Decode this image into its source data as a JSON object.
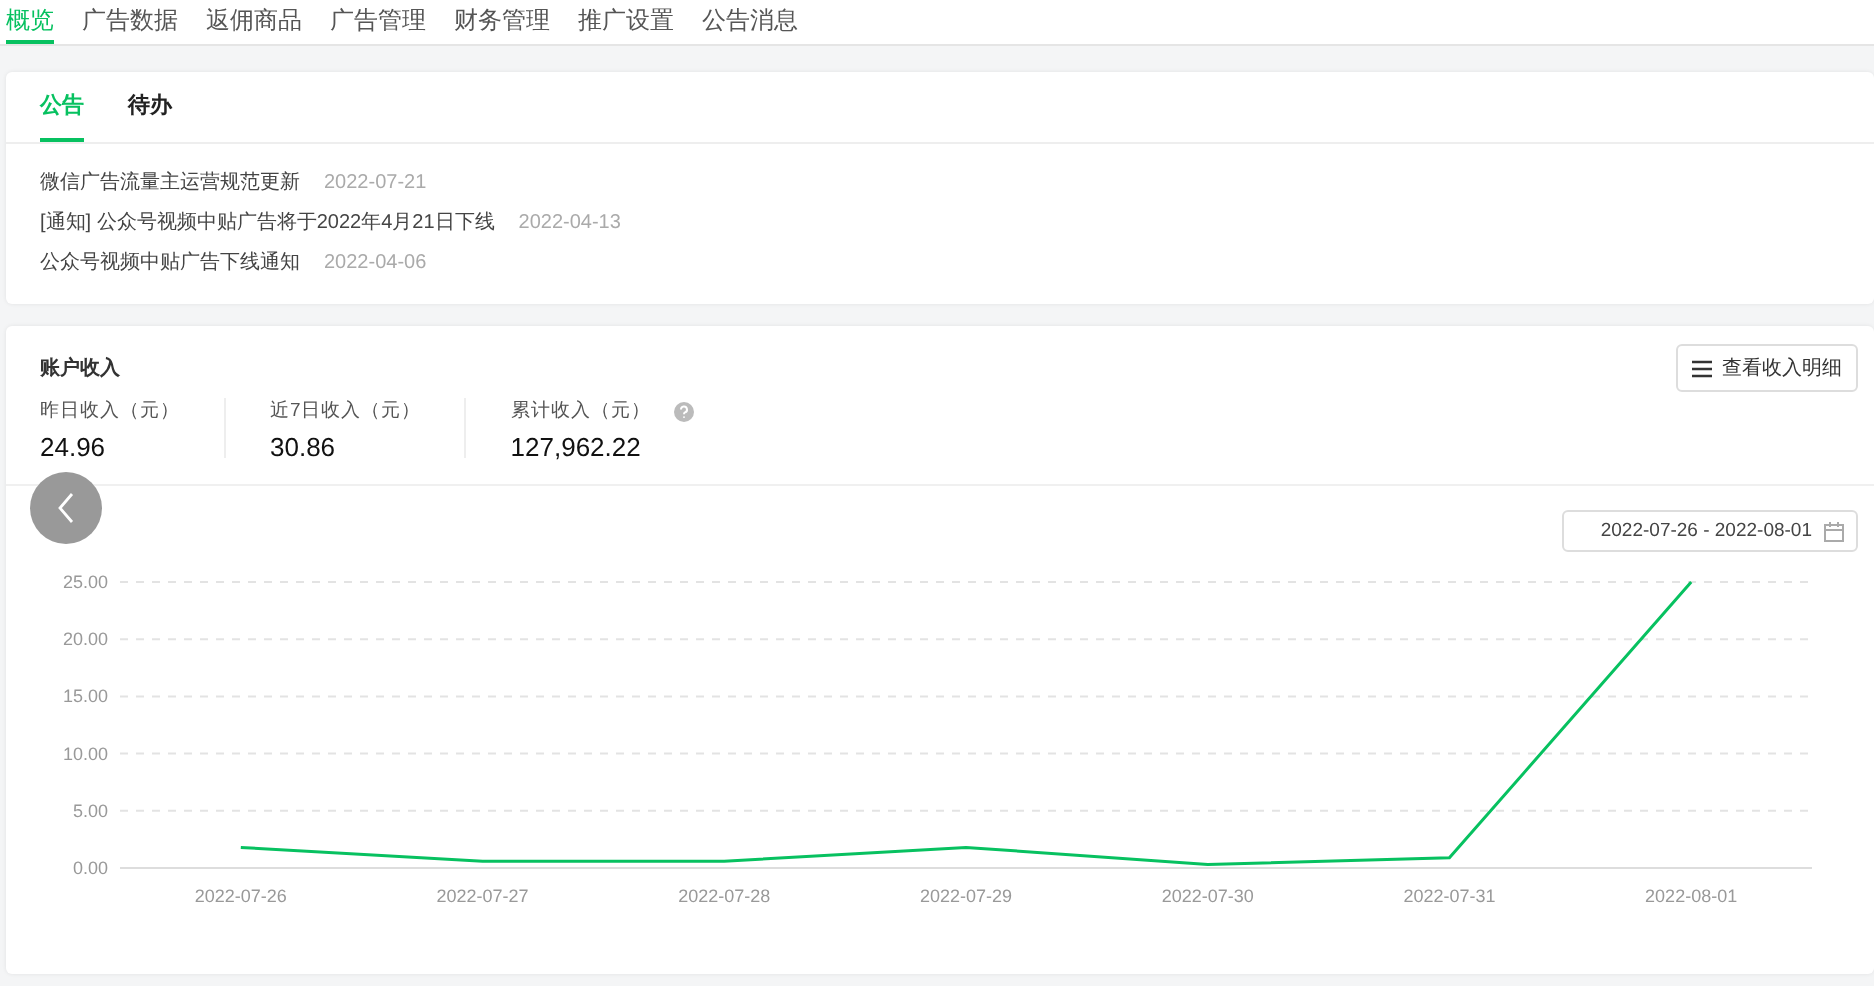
{
  "nav_tabs": [
    {
      "label": "概览",
      "selected": true
    },
    {
      "label": "广告数据",
      "selected": false
    },
    {
      "label": "返佣商品",
      "selected": false
    },
    {
      "label": "广告管理",
      "selected": false
    },
    {
      "label": "财务管理",
      "selected": false
    },
    {
      "label": "推广设置",
      "selected": false
    },
    {
      "label": "公告消息",
      "selected": false
    }
  ],
  "notice_card": {
    "tabs": [
      {
        "label": "公告",
        "selected": true
      },
      {
        "label": "待办",
        "selected": false
      }
    ],
    "items": [
      {
        "title": "微信广告流量主运营规范更新",
        "date": "2022-07-21"
      },
      {
        "title": "[通知] 公众号视频中贴广告将于2022年4月21日下线",
        "date": "2022-04-13"
      },
      {
        "title": "公众号视频中贴广告下线通知",
        "date": "2022-04-06"
      }
    ]
  },
  "income_card": {
    "title": "账户收入",
    "detail_button": "查看收入明细",
    "stats": [
      {
        "label": "昨日收入（元）",
        "value": "24.96",
        "help": false
      },
      {
        "label": "近7日收入（元）",
        "value": "30.86",
        "help": false
      },
      {
        "label": "累计收入（元）",
        "value": "127,962.22",
        "help": true
      }
    ],
    "date_range": "2022-07-26 - 2022-08-01",
    "chart_data": {
      "type": "line",
      "categories": [
        "2022-07-26",
        "2022-07-27",
        "2022-07-28",
        "2022-07-29",
        "2022-07-30",
        "2022-07-31",
        "2022-08-01"
      ],
      "series": [
        {
          "color": "#07c160",
          "values": [
            1.8,
            0.6,
            0.6,
            1.8,
            0.3,
            0.9,
            25
          ]
        }
      ],
      "grid": true,
      "ylim": [
        0,
        25
      ],
      "yticks": [
        {
          "value": 0,
          "label": "0.00"
        },
        {
          "value": 5,
          "label": "5.00"
        },
        {
          "value": 10,
          "label": "10.00"
        },
        {
          "value": 15,
          "label": "15.00"
        },
        {
          "value": 20,
          "label": "20.00"
        },
        {
          "value": 25,
          "label": "25.00"
        }
      ]
    }
  }
}
